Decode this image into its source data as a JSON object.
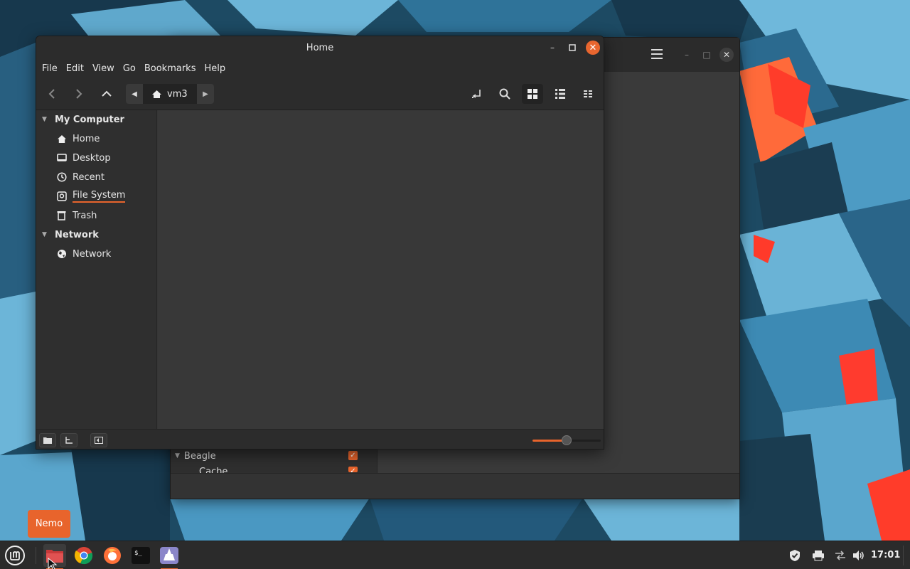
{
  "nemo": {
    "title": "Home",
    "menu": [
      "File",
      "Edit",
      "View",
      "Go",
      "Bookmarks",
      "Help"
    ],
    "path_segment": "vm3",
    "sidebar": {
      "sections": [
        {
          "label": "My Computer",
          "items": [
            "Home",
            "Desktop",
            "Recent",
            "File System",
            "Trash"
          ]
        },
        {
          "label": "Network",
          "items": [
            "Network"
          ]
        }
      ]
    },
    "zoom_level_fraction": 0.5
  },
  "back_window": {
    "rows": [
      {
        "label": "Beagle",
        "checked": true
      },
      {
        "label": "Cache",
        "checked": true
      }
    ]
  },
  "tooltip": "Nemo",
  "taskbar": {
    "apps": [
      "menu-icon",
      "files-icon",
      "chrome-icon",
      "firefox-icon",
      "terminal-icon",
      "bleachbit-icon"
    ],
    "clock": "17:01"
  },
  "colors": {
    "accent": "#e8642c",
    "window_bg": "#383838",
    "sidebar_bg": "#2f2f2f"
  }
}
